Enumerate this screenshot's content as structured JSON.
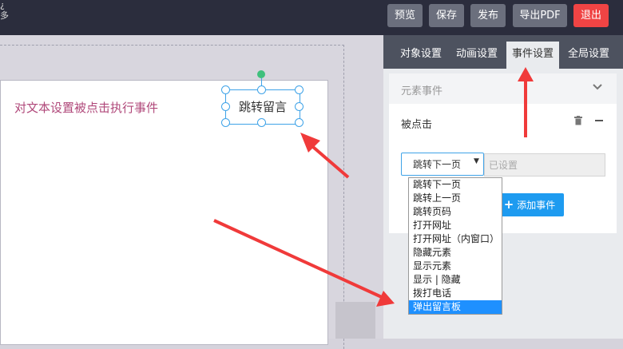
{
  "topbar": {
    "corner_text": [
      "¿",
      "多"
    ],
    "buttons": [
      {
        "label": "预览",
        "kind": "normal"
      },
      {
        "label": "保存",
        "kind": "normal"
      },
      {
        "label": "发布",
        "kind": "normal"
      },
      {
        "label": "导出PDF",
        "kind": "normal"
      },
      {
        "label": "退出",
        "kind": "danger"
      }
    ]
  },
  "canvas": {
    "page_text": "对文本设置被点击执行事件",
    "selected_text": "跳转留言"
  },
  "panel": {
    "tabs": [
      {
        "label": "对象设置",
        "active": false
      },
      {
        "label": "动画设置",
        "active": false
      },
      {
        "label": "事件设置",
        "active": true
      },
      {
        "label": "全局设置",
        "active": false
      }
    ],
    "section_title": "元素事件",
    "event_label": "被点击",
    "select_value": "跳转下一页",
    "status_placeholder": "已设置",
    "add_button": "添加事件",
    "dropdown_options": [
      "跳转下一页",
      "跳转上一页",
      "跳转页码",
      "打开网址",
      "打开网址（内窗口）",
      "隐藏元素",
      "显示元素",
      "显示 | 隐藏",
      "拨打电话",
      "弹出留言板"
    ],
    "dropdown_selected": "弹出留言板"
  },
  "colors": {
    "accent": "#1e90ff",
    "danger": "#f04444",
    "annotation": "#f03a3a",
    "page_text": "#b0487a"
  }
}
